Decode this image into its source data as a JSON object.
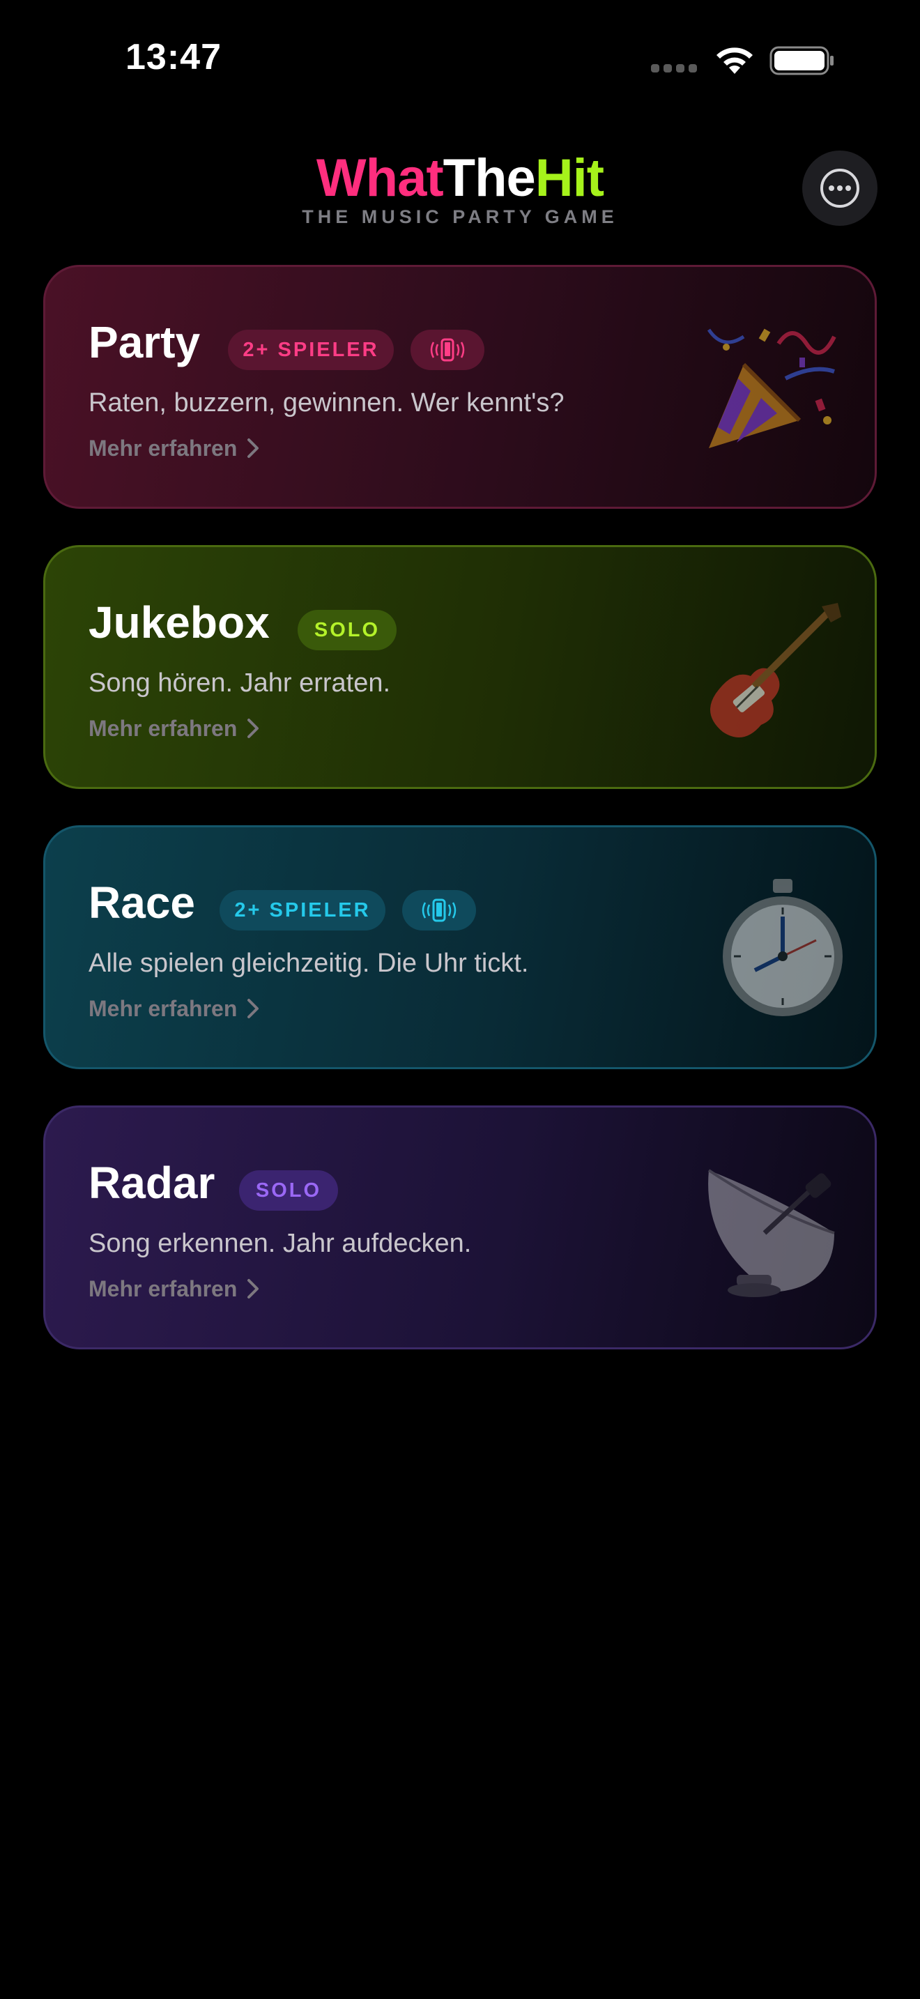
{
  "status_bar": {
    "time": "13:47"
  },
  "header": {
    "logo": {
      "part1": "What",
      "part2": "The",
      "part3": "Hit"
    },
    "tagline": "THE MUSIC PARTY GAME",
    "more_button_icon": "ellipsis-circle-icon"
  },
  "colors": {
    "pink": "#ff2e7e",
    "green": "#a6f21b",
    "cyan": "#1fc6e8",
    "purple": "#8f5cf6"
  },
  "modes": [
    {
      "title": "Party",
      "badge": "2+ SPIELER",
      "has_device_badge": true,
      "description": "Raten, buzzern, gewinnen. Wer kennt's?",
      "more_label": "Mehr erfahren",
      "art_icon": "party-popper-icon"
    },
    {
      "title": "Jukebox",
      "badge": "SOLO",
      "has_device_badge": false,
      "description": "Song hören. Jahr erraten.",
      "more_label": "Mehr erfahren",
      "art_icon": "guitar-icon"
    },
    {
      "title": "Race",
      "badge": "2+ SPIELER",
      "has_device_badge": true,
      "description": "Alle spielen gleichzeitig. Die Uhr tickt.",
      "more_label": "Mehr erfahren",
      "art_icon": "stopwatch-icon"
    },
    {
      "title": "Radar",
      "badge": "SOLO",
      "has_device_badge": false,
      "description": "Song erkennen. Jahr aufdecken.",
      "more_label": "Mehr erfahren",
      "art_icon": "satellite-dish-icon"
    }
  ]
}
